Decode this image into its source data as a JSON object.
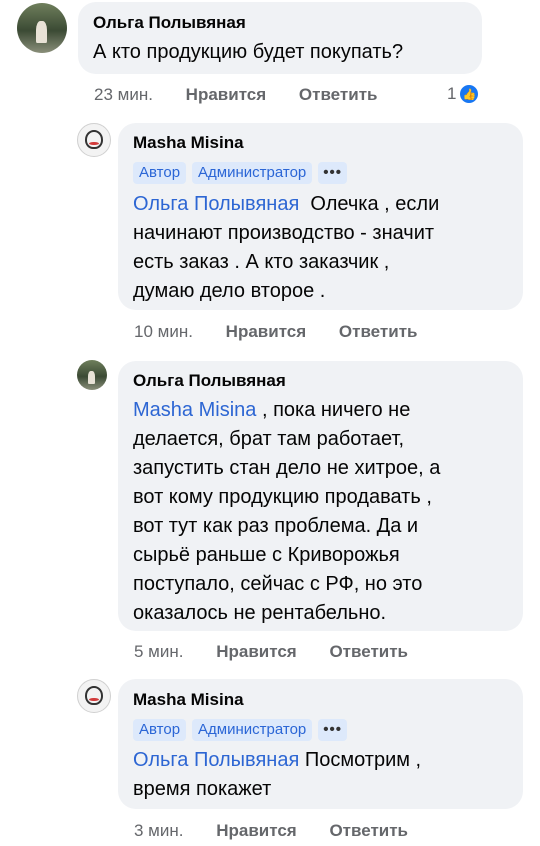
{
  "comments": [
    {
      "author": "Ольга Полывяная",
      "mention": "",
      "text": "А кто продукцию будет покупать?",
      "time": "23 мин.",
      "like": "Нравится",
      "reply": "Ответить",
      "reactions": "1",
      "reaction_icon": "like-icon"
    },
    {
      "author": "Masha Misina",
      "badges": [
        "Автор",
        "Администратор",
        "•••"
      ],
      "mention": "Ольга Полывяная",
      "lines": [
        "Олечка , если",
        "начинают производство - значит",
        "есть заказ . А кто заказчик ,",
        "думаю дело второе ."
      ],
      "time": "10 мин.",
      "like": "Нравится",
      "reply": "Ответить"
    },
    {
      "author": "Ольга Полывяная",
      "mention": "Masha Misina",
      "lines": [
        ", пока ничего не",
        "делается, брат там работает,",
        "запустить стан дело не хитрое, а",
        "вот кому продукцию продавать ,",
        "вот тут как раз проблема.  Да и",
        "сырьё раньше с Криворожья",
        "поступало, сейчас с РФ, но это",
        "оказалось не рентабельно."
      ],
      "time": "5 мин.",
      "like": "Нравится",
      "reply": "Ответить"
    },
    {
      "author": "Masha Misina",
      "badges": [
        "Автор",
        "Администратор",
        "•••"
      ],
      "mention": "Ольга Полывяная",
      "lines": [
        "Посмотрим ,",
        "время покажет"
      ],
      "time": "3 мин.",
      "like": "Нравится",
      "reply": "Ответить"
    }
  ]
}
